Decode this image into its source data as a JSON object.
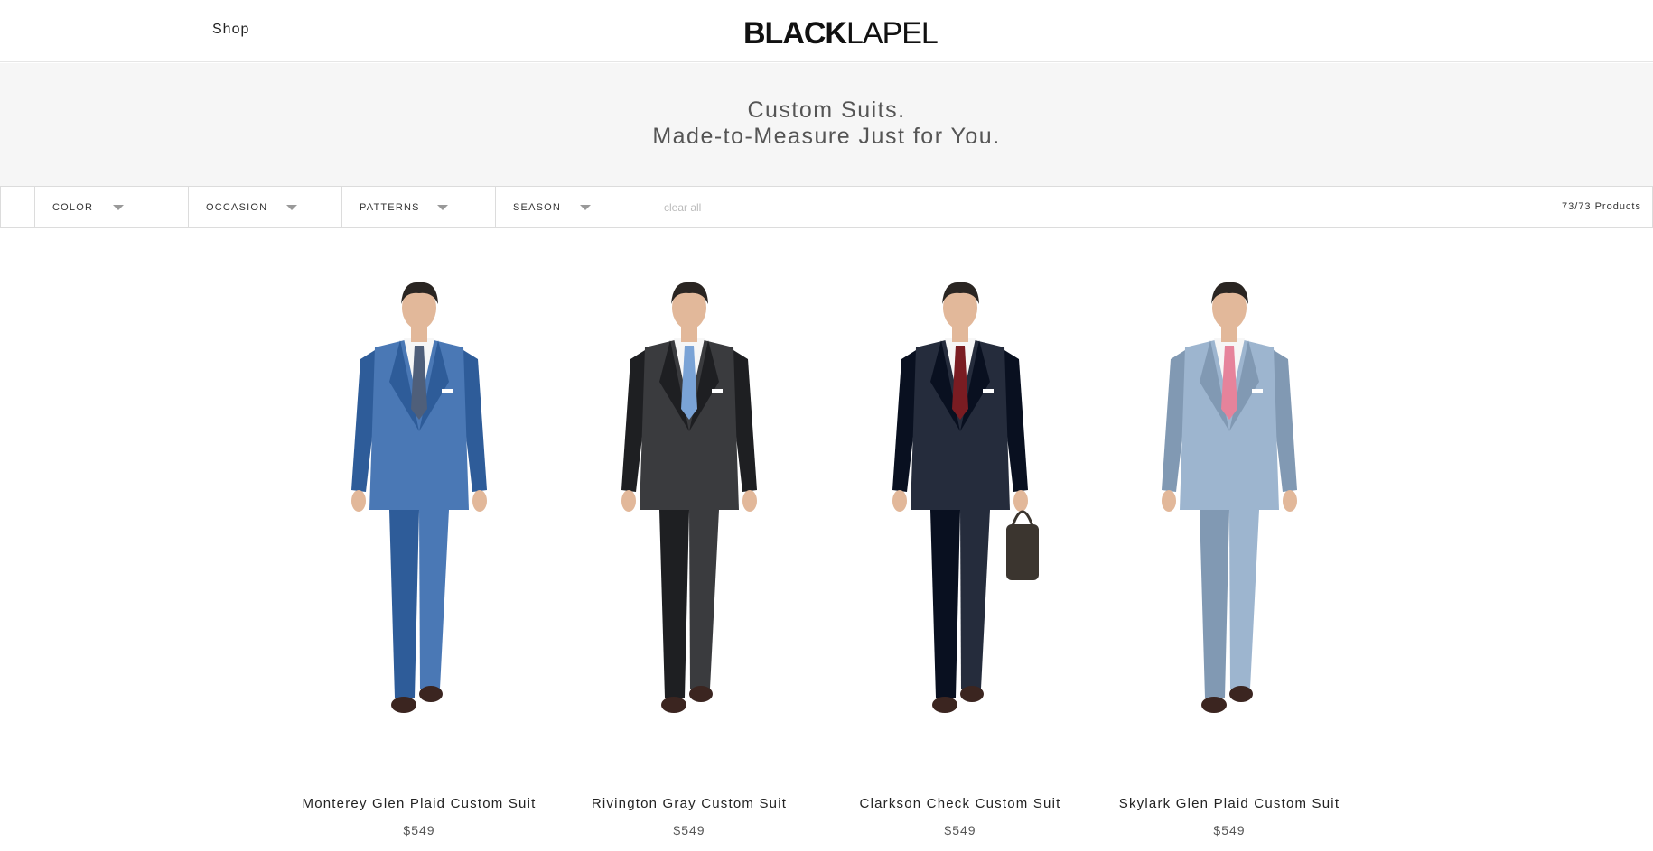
{
  "header": {
    "shop_label": "Shop",
    "logo_bold": "BLACK",
    "logo_light": "LAPEL"
  },
  "hero": {
    "line1": "Custom Suits.",
    "line2": "Made-to-Measure Just for You."
  },
  "filters": {
    "items": [
      {
        "label": "COLOR"
      },
      {
        "label": "OCCASION"
      },
      {
        "label": "PATTERNS"
      },
      {
        "label": "SEASON"
      }
    ],
    "clear_label": "clear all",
    "count_label": "73/73 Products"
  },
  "products": [
    {
      "name": "Monterey Glen Plaid Custom Suit",
      "price": "$549",
      "suit_color": "#4a78b5",
      "tie_color": "#4f5f7a",
      "pose": "hands-down"
    },
    {
      "name": "Rivington Gray Custom Suit",
      "price": "$549",
      "suit_color": "#3a3b3e",
      "tie_color": "#7aa3d6",
      "pose": "hand-on-chest"
    },
    {
      "name": "Clarkson Check Custom Suit",
      "price": "$549",
      "suit_color": "#252c3c",
      "tie_color": "#7a1c22",
      "pose": "holding-bag"
    },
    {
      "name": "Skylark Glen Plaid Custom Suit",
      "price": "$549",
      "suit_color": "#9db5cf",
      "tie_color": "#e6839b",
      "pose": "buttoning"
    }
  ]
}
